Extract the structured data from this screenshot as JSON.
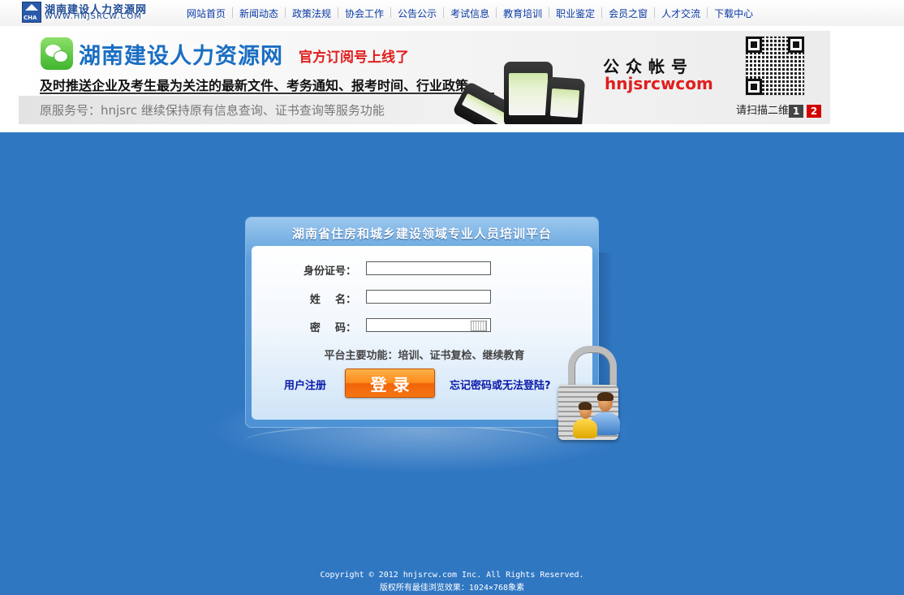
{
  "site": {
    "logo_cn": "湖南建设人力资源网",
    "logo_en": "WWW.HNJSRCW.COM",
    "logo_mark": "CHA"
  },
  "nav": {
    "items": [
      {
        "label": "网站首页"
      },
      {
        "label": "新闻动态"
      },
      {
        "label": "政策法规"
      },
      {
        "label": "协会工作"
      },
      {
        "label": "公告公示"
      },
      {
        "label": "考试信息"
      },
      {
        "label": "教育培训"
      },
      {
        "label": "职业鉴定"
      },
      {
        "label": "会员之窗"
      },
      {
        "label": "人才交流"
      },
      {
        "label": "下载中心"
      }
    ]
  },
  "banner": {
    "title": "湖南建设人力资源网",
    "tag": "官方订阅号上线了",
    "line1": "及时推送企业及考生最为关注的最新文件、考务通知、报考时间、行业政策",
    "line2": "原服务号：hnjsrc 继续保持原有信息查询、证书查询等服务功能",
    "account_label": "公众帐号",
    "account_id": "hnjsrcwcom",
    "scan_text": "请扫描二维码",
    "pager": [
      "1",
      "2"
    ],
    "active_page": "2"
  },
  "login": {
    "title": "湖南省住房和城乡建设领域专业人员培训平台",
    "id_label": "身份证号：",
    "name_label": "姓    名：",
    "password_label": "密    码：",
    "id_value": "",
    "name_value": "",
    "password_value": "",
    "platform_info": "平台主要功能：培训、证书复检、继续教育",
    "register_label": "用户注册",
    "login_label": "登录",
    "forgot_label": "忘记密码或无法登陆?"
  },
  "footer": {
    "copyright": "Copyright © 2012 hnjsrcw.com Inc. All Rights Reserved.",
    "best_view": "版权所有最佳浏览效果：1024×768象素"
  },
  "colors": {
    "main_bg": "#3077c2",
    "nav_link": "#0b3aa6",
    "login_button": "#ff8a1a",
    "banner_red": "#e01e1e",
    "banner_blue": "#1a6ec2"
  }
}
